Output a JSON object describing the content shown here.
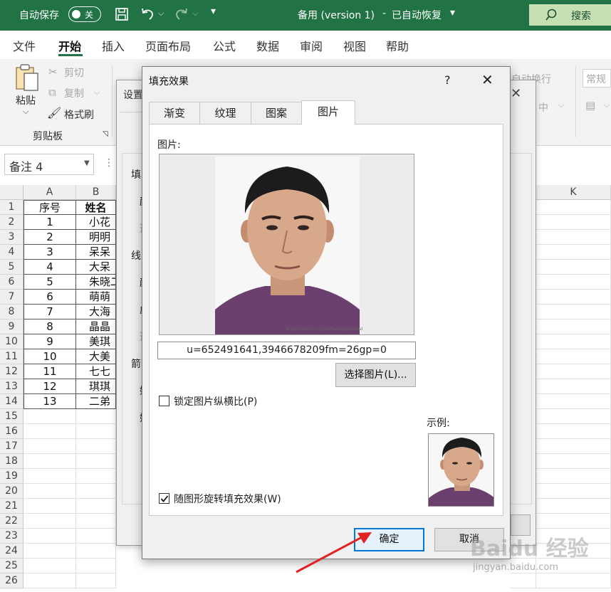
{
  "titlebar": {
    "autosave_label": "自动保存",
    "autosave_state": "关",
    "doc_title": "备用 (version 1)",
    "status": "已自动恢复",
    "search_label": "搜索"
  },
  "ribbon_tabs": [
    "文件",
    "开始",
    "插入",
    "页面布局",
    "公式",
    "数据",
    "审阅",
    "视图",
    "帮助"
  ],
  "ribbon": {
    "paste": "粘贴",
    "cut": "剪切",
    "copy": "复制",
    "format_painter": "格式刷",
    "clipboard_group": "剪贴板",
    "format_dim": "常规",
    "wrap_dim": "自动换行",
    "merge_dim": "中"
  },
  "name_box": "备注 4",
  "sheet": {
    "columns": [
      "A",
      "B",
      "K"
    ],
    "header_row": {
      "a": "序号",
      "b": "姓名"
    },
    "rows": [
      {
        "a": "1",
        "b": "小花"
      },
      {
        "a": "2",
        "b": "明明"
      },
      {
        "a": "3",
        "b": "呆呆"
      },
      {
        "a": "4",
        "b": "大呆"
      },
      {
        "a": "5",
        "b": "朱晓二"
      },
      {
        "a": "6",
        "b": "萌萌"
      },
      {
        "a": "7",
        "b": "大海"
      },
      {
        "a": "8",
        "b": "晶晶"
      },
      {
        "a": "9",
        "b": "美琪"
      },
      {
        "a": "10",
        "b": "大美"
      },
      {
        "a": "11",
        "b": "七七"
      },
      {
        "a": "12",
        "b": "琪琪"
      },
      {
        "a": "13",
        "b": "二弟"
      }
    ],
    "row_numbers": [
      "1",
      "2",
      "3",
      "4",
      "5",
      "6",
      "7",
      "8",
      "9",
      "10",
      "11",
      "12",
      "13",
      "14",
      "15",
      "16",
      "17",
      "18",
      "19",
      "20",
      "21",
      "22",
      "23",
      "24",
      "25",
      "26"
    ]
  },
  "bg_dialog": {
    "title": "设置",
    "labels": [
      "填",
      "颜",
      "透",
      "线",
      "颜",
      "虚",
      "透",
      "箭",
      "始",
      "始"
    ]
  },
  "dialog": {
    "title": "填充效果",
    "help": "?",
    "tabs": [
      "渐变",
      "纹理",
      "图案",
      "图片"
    ],
    "active_tab": "图片",
    "picture_label": "图片:",
    "filename": "u=652491641,3946678209fm=26gp=0",
    "select_button": "选择图片(L)...",
    "lock_aspect": "锁定图片纵横比(P)",
    "rotate_with_shape": "随图形旋转填充效果(W)",
    "sample_label": "示例:",
    "ok": "确定",
    "cancel": "取消",
    "watermark_small": "blog.sina.com.cn/jiazhuangqianshui"
  },
  "watermark": {
    "brand": "Baidu 经验",
    "url": "jingyan.baidu.com"
  },
  "colors": {
    "excel_green": "#217346",
    "arrow_red": "#e02424",
    "accent_blue": "#0078d7"
  }
}
